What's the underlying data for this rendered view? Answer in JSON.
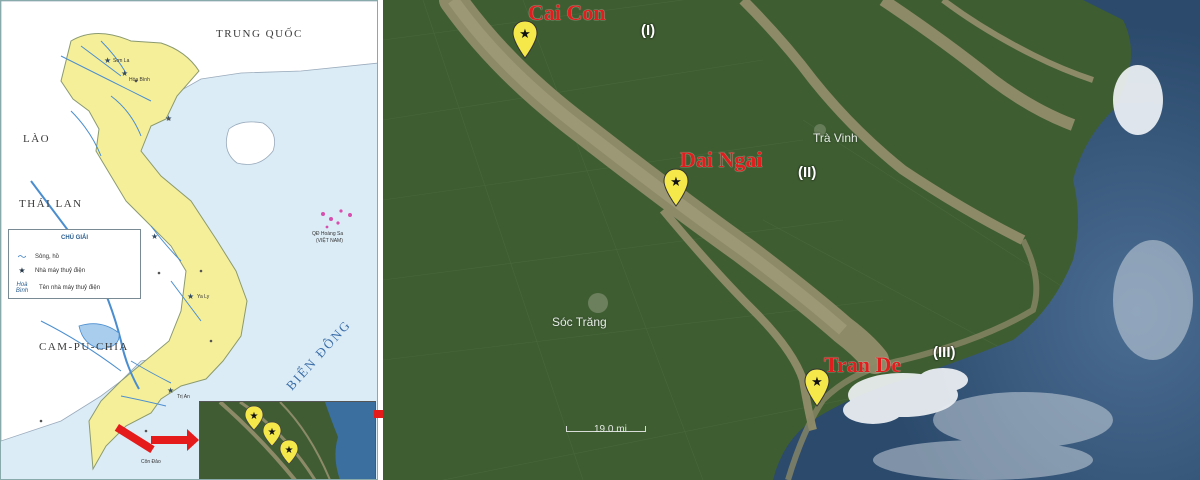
{
  "overview_map": {
    "countries": [
      "TRUNG QUỐC",
      "LÀO",
      "THÁI LAN",
      "CAM-PU-CHIA"
    ],
    "sea": "BIỂN ĐÔNG",
    "islands": "QĐ Hoàng Sa",
    "islands_note": "(VIỆT NAM)",
    "small_labels": [
      "Sơn La",
      "Hòa Bình",
      "Ya Ly",
      "Trị An",
      "Côn Đảo"
    ],
    "legend": {
      "title": "CHÚ GIẢI",
      "items": [
        {
          "symbol": "〜",
          "label": "Sông, hồ"
        },
        {
          "symbol": "★",
          "label": "Nhà máy thuỷ điện"
        },
        {
          "symbol": "Hoà Bình",
          "label": "Tên nhà máy thuỷ điện"
        }
      ]
    },
    "colors": {
      "vietnam_fill": "#f6ef9a",
      "neighbors_fill": "#ffffff",
      "sea": "#dcecf6",
      "river": "#4b8ed0",
      "arrow": "#e51b1b"
    }
  },
  "satellite_map": {
    "places": [
      "Trà Vinh",
      "Sóc Trăng"
    ],
    "sites": [
      {
        "name": "Cai Con",
        "numeral": "(I)"
      },
      {
        "name": "Dai Ngai",
        "numeral": "(II)"
      },
      {
        "name": "Tran De",
        "numeral": "(III)"
      }
    ],
    "scale_label": "19.0 mi",
    "colors": {
      "site_label": "#e11d1d",
      "pin_fill": "#f4e84a",
      "land": "#3e5d31",
      "river": "#8d8a68",
      "sea": "#2e4c6e"
    }
  }
}
